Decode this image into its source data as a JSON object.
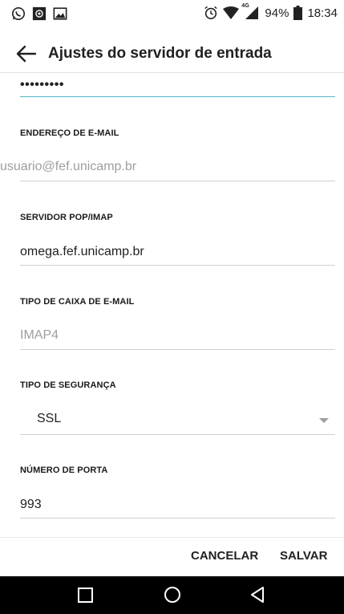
{
  "status_bar": {
    "battery_percent": "94%",
    "time": "18:34",
    "network_label": "4G",
    "icons_left": [
      "whatsapp-icon",
      "at-icon",
      "image-icon"
    ],
    "icons_right": [
      "alarm-icon",
      "wifi-icon",
      "signal-icon",
      "battery-icon"
    ]
  },
  "app_bar": {
    "title": "Ajustes do servidor de entrada"
  },
  "fields": {
    "password": {
      "value": "•••••••••"
    },
    "email": {
      "label": "ENDEREÇO DE E-MAIL",
      "value": "usuario@fef.unicamp.br"
    },
    "server": {
      "label": "SERVIDOR POP/IMAP",
      "value": "omega.fef.unicamp.br"
    },
    "mailbox_type": {
      "label": "TIPO DE CAIXA DE E-MAIL",
      "value": "IMAP4"
    },
    "security_type": {
      "label": "TIPO DE SEGURANÇA",
      "value": "SSL"
    },
    "port": {
      "label": "NÚMERO DE PORTA",
      "value": "993"
    }
  },
  "actions": {
    "cancel_label": "CANCELAR",
    "save_label": "SALVAR"
  },
  "nav": {
    "icons": [
      "recent-apps-icon",
      "home-icon",
      "back-icon"
    ]
  }
}
